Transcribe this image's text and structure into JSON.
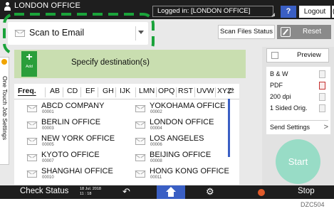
{
  "header": {
    "location_title": "LONDON OFFICE",
    "login_status": "Logged in: [LONDON OFFICE]",
    "help_label": "?",
    "logout_label": "Logout",
    "back_label": "("
  },
  "mode": {
    "selected": "Scan to Email"
  },
  "toolbar": {
    "scan_status_label": "Scan Files Status",
    "reset_label": "Reset"
  },
  "side_tab": {
    "label": "One Touch Job Settings"
  },
  "destination": {
    "add_label": "Add",
    "add_symbol": "+",
    "prompt": "Specify destination(s)"
  },
  "address_book": {
    "tabs": [
      "Freq.",
      "AB",
      "CD",
      "EF",
      "GH",
      "IJK",
      "LMN",
      "OPQ",
      "RST",
      "UVW",
      "XYZ"
    ],
    "active_tab": "Freq.",
    "more_symbol": "⇄",
    "entries": [
      {
        "name": "ABCD COMPANY",
        "number": "00001"
      },
      {
        "name": "YOKOHAMA OFFICE",
        "number": "00002"
      },
      {
        "name": "BERLIN OFFICE",
        "number": "00003"
      },
      {
        "name": "LONDON OFFICE",
        "number": "00004"
      },
      {
        "name": "NEW YORK OFFICE",
        "number": "00005"
      },
      {
        "name": "LOS ANGELES",
        "number": "00006"
      },
      {
        "name": "KYOTO OFFICE",
        "number": "00007"
      },
      {
        "name": "BEIJING OFFICE",
        "number": "00008"
      },
      {
        "name": "SHANGHAI  OFFICE",
        "number": "00010"
      },
      {
        "name": "HONG KONG OFFICE",
        "number": "00011"
      }
    ]
  },
  "right_panel": {
    "preview_label": "Preview",
    "settings": [
      "B & W",
      "PDF",
      "200 dpi",
      "1 Sided Orig."
    ],
    "send_settings_label": "Send Settings",
    "start_label": "Start"
  },
  "bottom": {
    "check_status_label": "Check Status",
    "date": "18 Jul. 2018",
    "time": "11 : 18",
    "stop_label": "Stop"
  },
  "figure_code": "DZC504",
  "colors": {
    "accent_blue": "#3a5fc4",
    "add_green": "#2a9e3a",
    "destination_panel": "#c9deb0",
    "start_button": "#98dcc6",
    "highlight_dash": "#1aa33a"
  },
  "icons": [
    "user-icon",
    "help-icon",
    "mail-icon",
    "dropdown-arrow-icon",
    "reset-icon",
    "home-icon",
    "gear-icon",
    "back-arrow-icon",
    "stop-icon",
    "scroll-icon"
  ]
}
